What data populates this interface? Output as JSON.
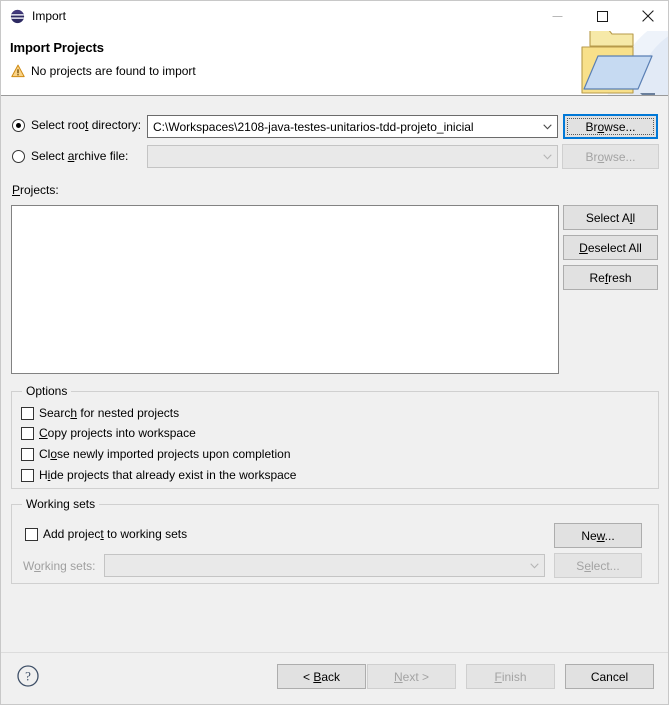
{
  "window": {
    "title": "Import",
    "app_icon": "eclipse-icon",
    "controls": {
      "minimize": "minimize-icon",
      "maximize": "maximize-icon",
      "close": "close-icon"
    }
  },
  "header": {
    "title": "Import Projects",
    "message": "No projects are found to import",
    "message_icon": "warning-icon",
    "illustration": "import-folder-icon",
    "warning_color": "#f5a623"
  },
  "source": {
    "root_directory": {
      "label_before": "Select roo",
      "label_mnemonic": "t",
      "label_after": " directory:",
      "selected": true,
      "value": "C:\\Workspaces\\2108-java-testes-unitarios-tdd-projeto_inicial",
      "browse_label_before": "Br",
      "browse_mnemonic": "o",
      "browse_label_after": "wse...",
      "browse_enabled": true,
      "browse_focused": true
    },
    "archive_file": {
      "label_before": "Select ",
      "label_mnemonic": "a",
      "label_after": "rchive file:",
      "selected": false,
      "value": "",
      "browse_label_before": "Br",
      "browse_mnemonic": "o",
      "browse_label_after": "wse...",
      "browse_enabled": false
    }
  },
  "projects": {
    "label_before": "",
    "label_mnemonic": "P",
    "label_after": "rojects:",
    "items": [],
    "buttons": [
      {
        "name": "select-all",
        "before": "Select A",
        "mnemonic": "l",
        "after": "l",
        "enabled": true
      },
      {
        "name": "deselect-all",
        "before": "",
        "mnemonic": "D",
        "after": "eselect All",
        "enabled": true
      },
      {
        "name": "refresh",
        "before": "Re",
        "mnemonic": "f",
        "after": "resh",
        "enabled": true
      }
    ]
  },
  "options": {
    "title": "Options",
    "items": [
      {
        "name": "search-nested-projects",
        "before": "Searc",
        "mnemonic": "h",
        "after": " for nested projects",
        "checked": false
      },
      {
        "name": "copy-projects-into-workspace",
        "before": "",
        "mnemonic": "C",
        "after": "opy projects into workspace",
        "checked": false
      },
      {
        "name": "close-newly-imported-projects",
        "before": "Cl",
        "mnemonic": "o",
        "after": "se newly imported projects upon completion",
        "checked": false
      },
      {
        "name": "hide-existing-projects",
        "before": "H",
        "mnemonic": "i",
        "after": "de projects that already exist in the workspace",
        "checked": false
      }
    ]
  },
  "working_sets": {
    "title": "Working sets",
    "add_checkbox": {
      "before": "Add projec",
      "mnemonic": "t",
      "after": " to working sets",
      "checked": false
    },
    "new_button": {
      "before": "Ne",
      "mnemonic": "w",
      "after": "...",
      "enabled": true
    },
    "combo_label": {
      "before": "W",
      "mnemonic": "o",
      "after": "rking sets:",
      "enabled": false
    },
    "combo_value": "",
    "select_button": {
      "before": "S",
      "mnemonic": "e",
      "after": "lect...",
      "enabled": false
    }
  },
  "footer": {
    "help_icon": "help-icon",
    "buttons": [
      {
        "name": "back",
        "before": "< ",
        "mnemonic": "B",
        "after": "ack",
        "enabled": true
      },
      {
        "name": "next",
        "before": "",
        "mnemonic": "N",
        "after": "ext >",
        "enabled": false
      },
      {
        "name": "finish",
        "before": "",
        "mnemonic": "F",
        "after": "inish",
        "enabled": false
      },
      {
        "name": "cancel",
        "before": "Cancel",
        "mnemonic": "",
        "after": "",
        "enabled": true
      }
    ]
  }
}
